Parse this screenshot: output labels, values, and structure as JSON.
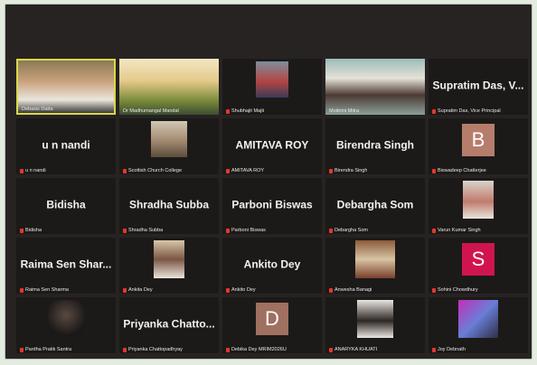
{
  "tiles": [
    {
      "type": "video",
      "label": "Debasis Datta",
      "active": true
    },
    {
      "type": "video",
      "label": "Dr Madhumangal Mandal"
    },
    {
      "type": "photo",
      "label": "Shubhajit Majti"
    },
    {
      "type": "video",
      "label": "Moitrimi Mitra"
    },
    {
      "type": "name",
      "name": "Supratim Das, V...",
      "label": "Supratim Das, Vice Principal"
    },
    {
      "type": "name",
      "name": "u n nandi",
      "label": "u n nandi"
    },
    {
      "type": "photo",
      "label": "Scottish Church College"
    },
    {
      "type": "name",
      "name": "AMITAVA ROY",
      "label": "AMITAVA ROY"
    },
    {
      "type": "name",
      "name": "Birendra Singh",
      "label": "Birendra Singh"
    },
    {
      "type": "letter",
      "letter": "B",
      "color": "#b77d6c",
      "label": "Biswadeep Chatterjee"
    },
    {
      "type": "name",
      "name": "Bidisha",
      "label": "Bidisha"
    },
    {
      "type": "name",
      "name": "Shradha Subba",
      "label": "Shradha Subba"
    },
    {
      "type": "name",
      "name": "Parboni Biswas",
      "label": "Parboni Biswas"
    },
    {
      "type": "name",
      "name": "Debargha Som",
      "label": "Debargha Som"
    },
    {
      "type": "photo",
      "label": "Varun Kumar Singh"
    },
    {
      "type": "name",
      "name": "Raima Sen Shar...",
      "label": "Raima Sen Sharma"
    },
    {
      "type": "photo",
      "label": "Ankita Dey"
    },
    {
      "type": "name",
      "name": "Ankito Dey",
      "label": "Ankito Dey"
    },
    {
      "type": "photo",
      "label": "Anwesha Banagi"
    },
    {
      "type": "letter",
      "letter": "S",
      "color": "#d0154e",
      "label": "Sohini Chowdhury"
    },
    {
      "type": "photo",
      "label": "Pardha Pratik Santra"
    },
    {
      "type": "name",
      "name": "Priyanka Chatto...",
      "label": "Priyanka Chattopadhyay"
    },
    {
      "type": "letter",
      "letter": "D",
      "color": "#a07060",
      "label": "Debika Dey MRIM2026U"
    },
    {
      "type": "photo",
      "label": "ANARYKA KHUATI"
    },
    {
      "type": "photo",
      "label": "Joy Debnath"
    }
  ]
}
